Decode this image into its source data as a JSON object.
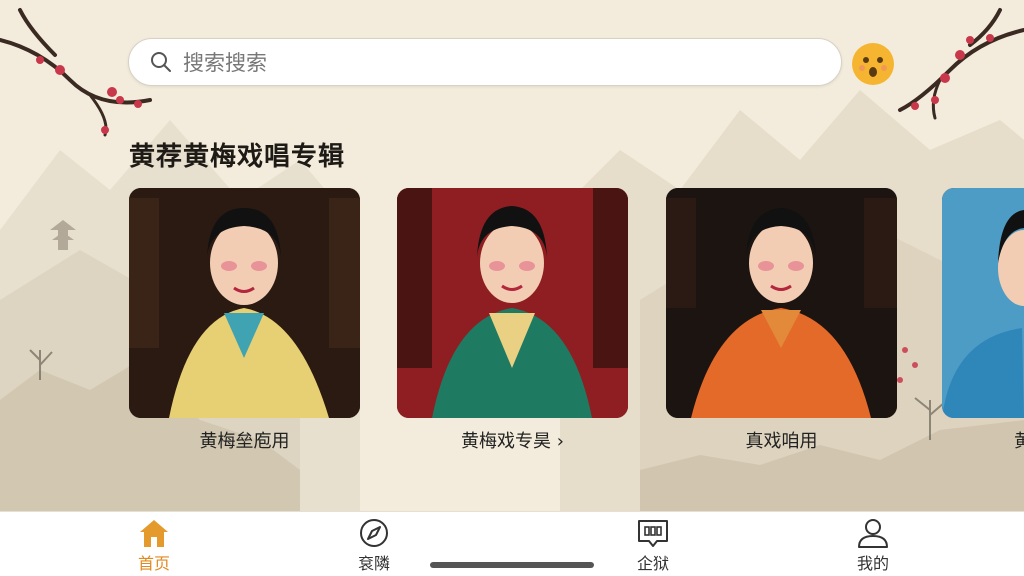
{
  "search": {
    "placeholder": "搜索搜索"
  },
  "section": {
    "title": "黄荐黄梅戏唱专辑"
  },
  "cards": [
    {
      "label": "黄梅垒庖用",
      "robe": "#e7cf74",
      "collar": "#3fa3b2",
      "backdrop": "#2b1a12"
    },
    {
      "label": "黄梅戏专昊 ›",
      "robe": "#1f7a62",
      "collar": "#e9d083",
      "backdrop": "#8e1e22"
    },
    {
      "label": "真戏咱用",
      "robe": "#e46a2a",
      "collar": "#e38a3a",
      "backdrop": "#1c1410"
    },
    {
      "label": "黄",
      "robe": "#2f86b9",
      "collar": "#5aa6cf",
      "backdrop": "#4d9cc5"
    }
  ],
  "tabs": [
    {
      "label": "首页",
      "icon": "home-icon",
      "active": true
    },
    {
      "label": "袞隣",
      "icon": "compass-icon",
      "active": false
    },
    {
      "label": "企狱",
      "icon": "message-icon",
      "active": false
    },
    {
      "label": "我的",
      "icon": "person-icon",
      "active": false
    }
  ],
  "colors": {
    "accent": "#e08a1e",
    "background": "#f3ecdc"
  }
}
